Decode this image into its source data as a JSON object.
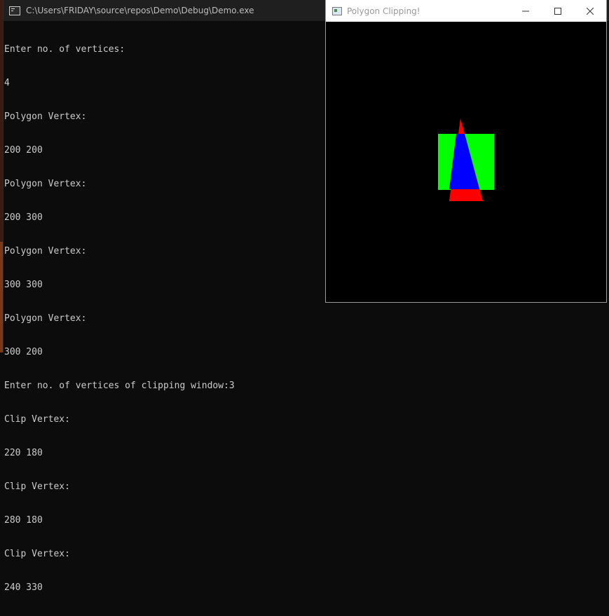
{
  "console": {
    "title": "C:\\Users\\FRIDAY\\source\\repos\\Demo\\Debug\\Demo.exe",
    "lines": [
      "Enter no. of vertices:",
      "4",
      "Polygon Vertex:",
      "200 200",
      "Polygon Vertex:",
      "200 300",
      "Polygon Vertex:",
      "300 300",
      "Polygon Vertex:",
      "300 200",
      "Enter no. of vertices of clipping window:3",
      "Clip Vertex:",
      "220 180",
      "Clip Vertex:",
      "280 180",
      "Clip Vertex:",
      "240 330"
    ]
  },
  "gl_window": {
    "title": "Polygon Clipping!",
    "colors": {
      "polygon": "#00ff00",
      "clip_window": "#ff0000",
      "clipped": "#0000ff",
      "background": "#000000"
    }
  }
}
